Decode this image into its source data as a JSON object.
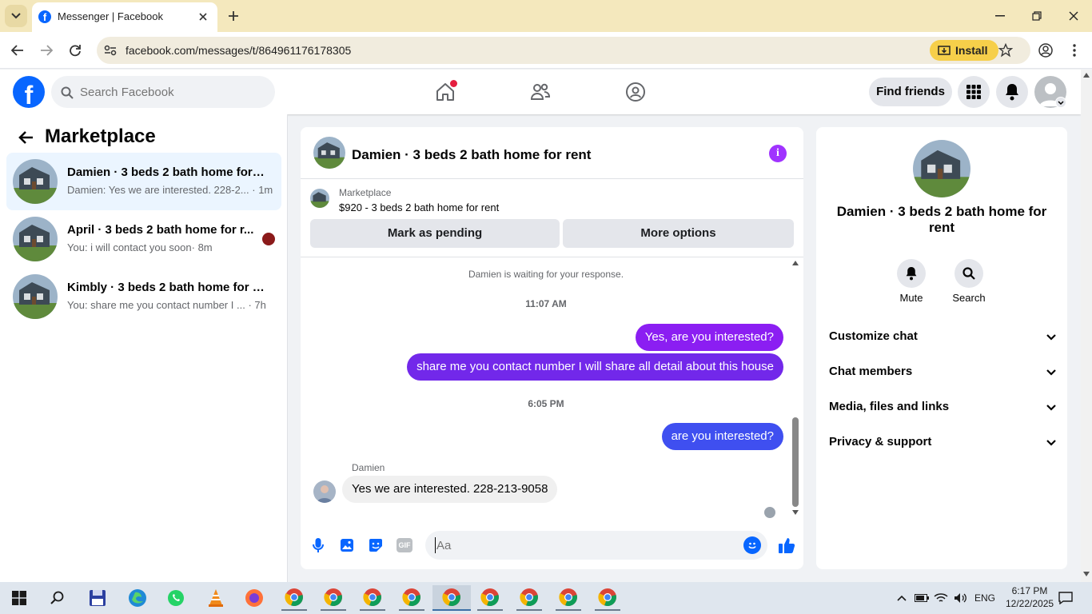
{
  "browser": {
    "tab_title": "Messenger | Facebook",
    "url": "facebook.com/messages/t/864961176178305",
    "install_label": "Install"
  },
  "fb_header": {
    "search_placeholder": "Search Facebook",
    "find_friends_label": "Find friends"
  },
  "left_panel": {
    "title": "Marketplace",
    "conversations": [
      {
        "name": "Damien · 3 beds 2 bath home for r...",
        "preview": "Damien: Yes we are interested. 228-2...",
        "time": "· 1m"
      },
      {
        "name": "April · 3 beds 2 bath home for r...",
        "preview": "You: i will contact you soon",
        "time": "· 8m"
      },
      {
        "name": "Kimbly · 3 beds 2 bath home for re...",
        "preview": "You: share me you contact number I ...",
        "time": "· 7h"
      }
    ]
  },
  "chat": {
    "header_title": "Damien · 3 beds 2 bath home for rent",
    "listing_source": "Marketplace",
    "listing_summary": "$920 - 3 beds 2 bath home for rent",
    "mark_pending_label": "Mark as pending",
    "more_options_label": "More options",
    "system_note": "Damien is waiting for your response.",
    "timestamp_1": "11:07 AM",
    "timestamp_2": "6:05 PM",
    "messages": [
      {
        "from": "me",
        "text": "Yes, are you interested?"
      },
      {
        "from": "me",
        "text": "share me you contact number I will share all detail about this house"
      },
      {
        "from": "me",
        "text": "are you interested?"
      },
      {
        "from": "Damien",
        "text": "Yes we are interested. 228-213-9058"
      }
    ],
    "sender_label": "Damien",
    "composer_placeholder": "Aa"
  },
  "right_panel": {
    "title": "Damien · 3 beds 2 bath home for rent",
    "mute_label": "Mute",
    "search_label": "Search",
    "sections": [
      "Customize chat",
      "Chat members",
      "Media, files and links",
      "Privacy & support"
    ]
  },
  "taskbar": {
    "time": "6:17 PM",
    "date": "12/22/2025",
    "lang": "ENG"
  },
  "colors": {
    "fb_blue": "#0866ff",
    "messenger_purple": "#7c1ff0",
    "chrome_tab_strip": "#f4e8bd"
  }
}
